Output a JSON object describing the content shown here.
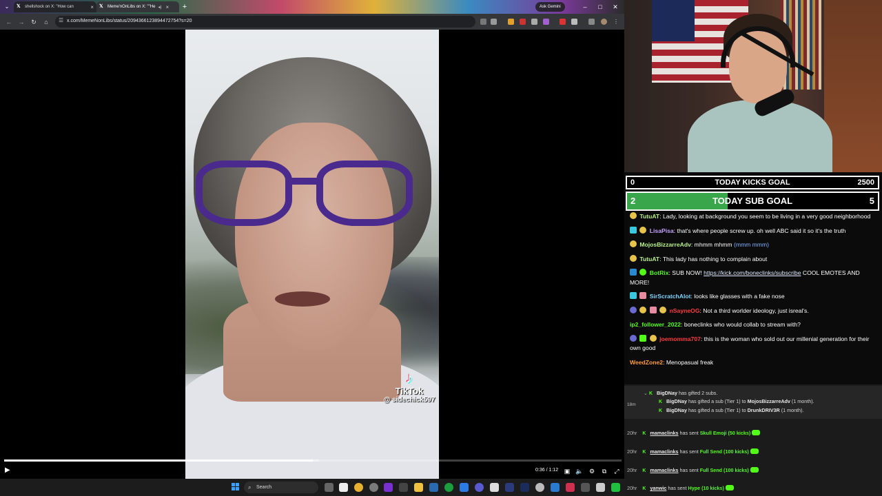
{
  "browser": {
    "tabs": [
      {
        "label": "shellshock on X: \"How can",
        "active": false
      },
      {
        "label": "Meme'nOnLibs on X: \"\"He",
        "active": true
      }
    ],
    "ask_gemini": "Ask Gemini",
    "url": "x.com/MemeNonLibs/status/2094366123894472754?s=20"
  },
  "video": {
    "watermark_brand": "TikTok",
    "watermark_handle": "@ sidechick597",
    "time": "0:36 / 1:12",
    "progress": 0.5,
    "buffered": 0.51
  },
  "taskbar": {
    "search_placeholder": "Search"
  },
  "overlay": {
    "kicks_goal": {
      "label": "TODAY KICKS GOAL",
      "current": "0",
      "target": "2500",
      "progress": 0
    },
    "sub_goal": {
      "label": "TODAY SUB GOAL",
      "current": "2",
      "target": "5",
      "progress": 0.4
    },
    "chat": [
      {
        "user": "TutuAT",
        "color": "#b8f08a",
        "text": "Lady, looking at background you seem to be living in a very good neighborhood"
      },
      {
        "user": "LisaPisa",
        "color": "#c8a2ff",
        "text": "that's where people screw up. oh well ABC said it so it's the truth"
      },
      {
        "user": "MojosBizzarreAdv",
        "color": "#b8f08a",
        "text": "mhmm mhmm",
        "emote": "(mmm mmm)"
      },
      {
        "user": "TutuAT",
        "color": "#b8f08a",
        "text": "This lady has nothing to complain about"
      },
      {
        "user": "BotRix",
        "color": "#53fc18",
        "text_before": "SUB NOW!",
        "link": "https://kick.com/boneclinks/subscribe",
        "text": "COOL EMOTES AND MORE!"
      },
      {
        "user": "SirScratchAlot",
        "color": "#7fd4ff",
        "text": "looks like glasses with a fake nose"
      },
      {
        "user": "nSayneOG",
        "color": "#ff3b3b",
        "text": "Not a third worlder ideology, just isreal's."
      },
      {
        "user": "ip2_follower_2022",
        "color": "#53fc18",
        "text": "boneclinks who would collab to stream with?"
      },
      {
        "user": "joemomma707",
        "color": "#ff3b3b",
        "text": "this is the woman who sold out our millenial generation for their own good"
      },
      {
        "user": "WeedZone2",
        "color": "#ff9b3a",
        "text": "Menopasual freak"
      }
    ],
    "gift": {
      "time": "18m",
      "header_user": "BigDNay",
      "header_text": "has gifted 2 subs.",
      "lines": [
        {
          "user": "BigDNay",
          "text": "has gifted a sub (Tier 1) to",
          "target": "MojosBizzarreAdv",
          "suffix": "(1 month)."
        },
        {
          "user": "BigDNay",
          "text": "has gifted a sub (Tier 1) to",
          "target": "DrunkDRIV3R",
          "suffix": "(1 month)."
        }
      ]
    },
    "kicks": [
      {
        "time": "20hr",
        "user": "mamaclinks",
        "text": "has sent",
        "item": "Skull Emoji (50 kicks)"
      },
      {
        "time": "20hr",
        "user": "mamaclinks",
        "text": "has sent",
        "item": "Full Send (100 kicks)"
      },
      {
        "time": "20hr",
        "user": "mamaclinks",
        "text": "has sent",
        "item": "Full Send (100 kicks)"
      },
      {
        "time": "20hr",
        "user": "yanwic",
        "text": "has sent",
        "item": "Hype (10 kicks)"
      }
    ]
  }
}
